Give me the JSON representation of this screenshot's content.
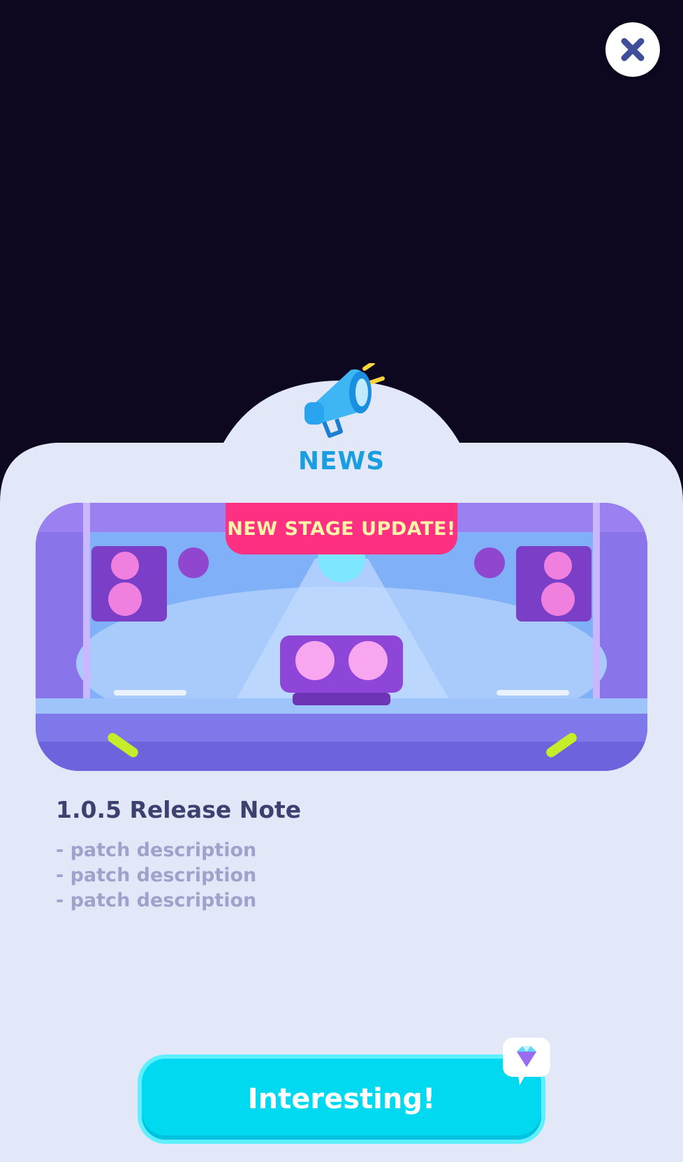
{
  "close": {
    "icon": "close-icon"
  },
  "header": {
    "icon": "megaphone-icon",
    "title": "NEWS"
  },
  "banner": {
    "badge": "NEW STAGE UPDATE!",
    "image": "dj-stage-illustration"
  },
  "notes": {
    "title": "1.0.5 Release Note",
    "items": [
      "- patch description",
      "- patch description",
      "- patch description"
    ]
  },
  "action": {
    "label": "Interesting!",
    "reward_icon": "gem-icon"
  },
  "colors": {
    "background": "#0d0820",
    "panel": "#e2e8f7",
    "title": "#1a9ee0",
    "badge": "#ff2f82",
    "badge_text": "#fff5a8",
    "button": "#00d9f0",
    "note_title": "#3d4170",
    "note_text": "#9fa3cc"
  }
}
